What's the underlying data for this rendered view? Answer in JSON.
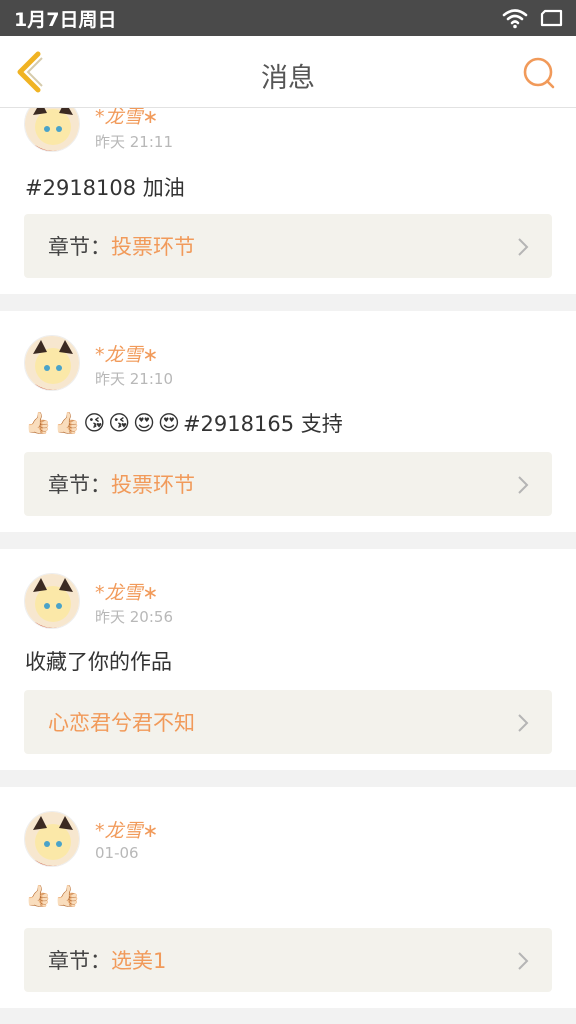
{
  "status_bar": {
    "date": "1月7日周日",
    "wifi_icon": "wifi-icon",
    "battery_icon": "battery-icon"
  },
  "nav": {
    "title": "消息",
    "back_icon": "back-chevron-icon",
    "search_icon": "search-icon"
  },
  "colors": {
    "accent": "#f19a5a",
    "chapter_bg": "#f3f2ec",
    "separator": "#f2f2f2"
  },
  "messages": [
    {
      "user": "*龙雪∗",
      "time": "昨天 21:11",
      "text": "#2918108 加油",
      "emojis": [],
      "chapter_label": "章节：",
      "chapter_value": "投票环节"
    },
    {
      "user": "*龙雪∗",
      "time": "昨天 21:10",
      "text": "#2918165 支持",
      "emojis": [
        "👍🏻",
        "👍🏻",
        "😘",
        "😘",
        "😍",
        "😍"
      ],
      "chapter_label": "章节：",
      "chapter_value": "投票环节"
    },
    {
      "user": "*龙雪∗",
      "time": "昨天 20:56",
      "text": "收藏了你的作品",
      "emojis": [],
      "chapter_label": "",
      "chapter_value": "心恋君兮君不知"
    },
    {
      "user": "*龙雪∗",
      "time": "01-06",
      "text": "",
      "emojis": [
        "👍🏻",
        "👍🏻"
      ],
      "chapter_label": "章节：",
      "chapter_value": "选美1"
    }
  ]
}
